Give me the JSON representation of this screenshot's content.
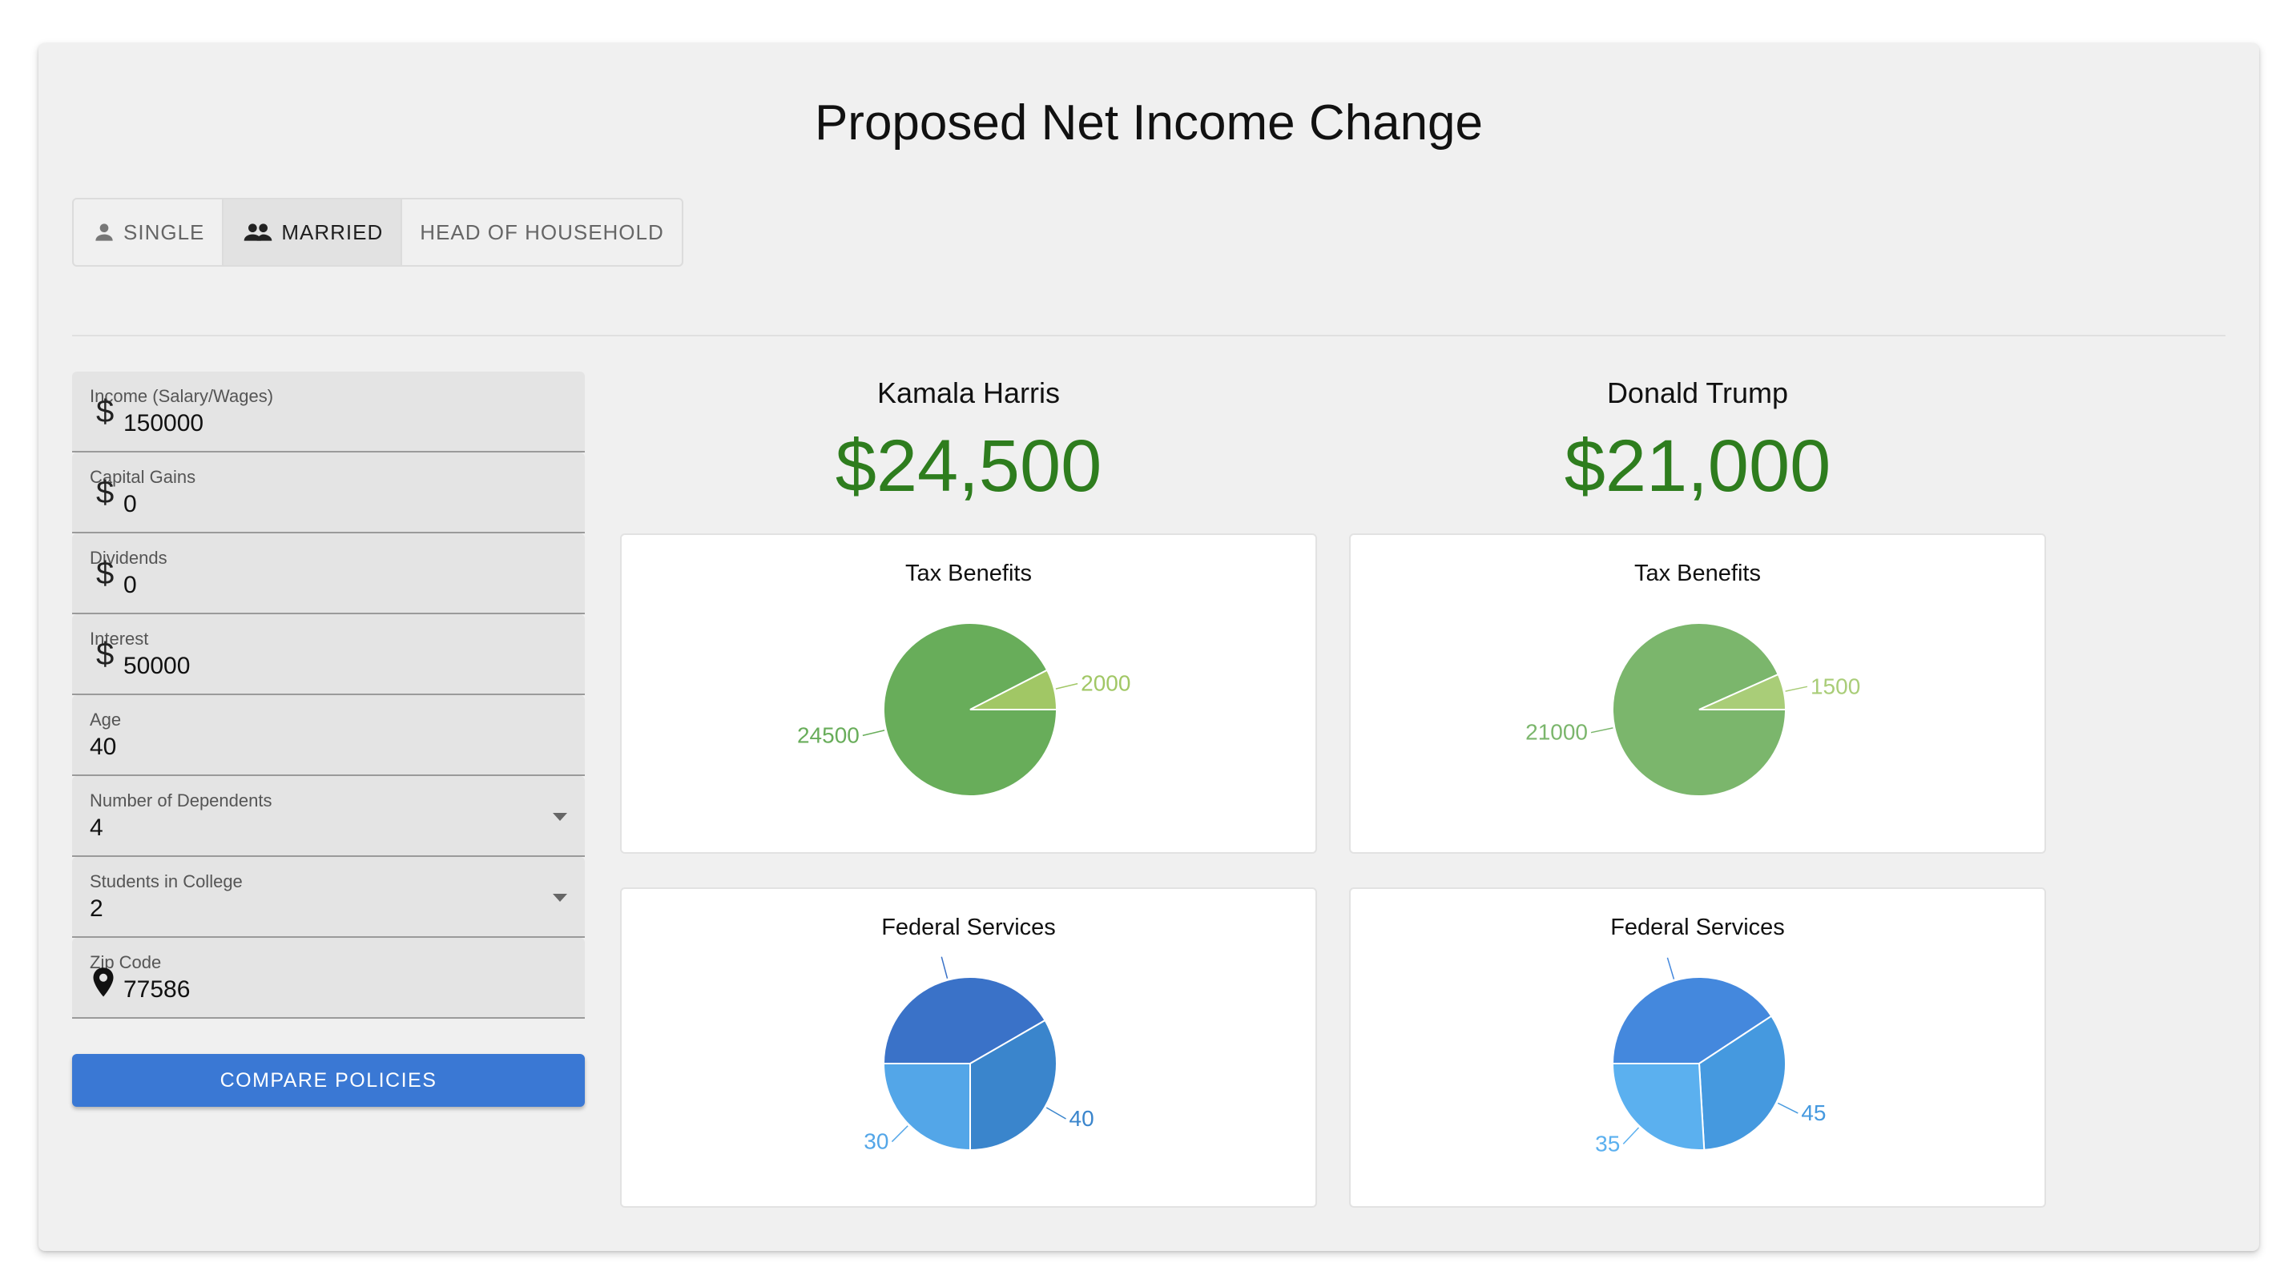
{
  "title": "Proposed Net Income Change",
  "filing_status": {
    "options": [
      {
        "label": "SINGLE",
        "icon": "person-icon",
        "active": false
      },
      {
        "label": "MARRIED",
        "icon": "people-icon",
        "active": true
      },
      {
        "label": "HEAD OF HOUSEHOLD",
        "icon": "",
        "active": false
      }
    ]
  },
  "form": {
    "income": {
      "label": "Income (Salary/Wages)",
      "value": "150000",
      "adornment": "$"
    },
    "capital_gains": {
      "label": "Capital Gains",
      "value": "0",
      "adornment": "$"
    },
    "dividends": {
      "label": "Dividends",
      "value": "0",
      "adornment": "$"
    },
    "interest": {
      "label": "Interest",
      "value": "50000",
      "adornment": "$"
    },
    "age": {
      "label": "Age",
      "value": "40"
    },
    "dependents": {
      "label": "Number of Dependents",
      "value": "4"
    },
    "students": {
      "label": "Students in College",
      "value": "2"
    },
    "zip": {
      "label": "Zip Code",
      "value": "77586",
      "icon": "location-pin-icon"
    },
    "compare_label": "COMPARE POLICIES"
  },
  "candidates": [
    {
      "name": "Kamala Harris",
      "amount": "$24,500"
    },
    {
      "name": "Donald Trump",
      "amount": "$21,000"
    }
  ],
  "colors": {
    "accent": "#3a78d4",
    "amount": "#2e7d1e",
    "harris_tax": [
      "#68ad5a",
      "#a1c765"
    ],
    "trump_tax": [
      "#7bb66c",
      "#a9cd78"
    ],
    "harris_fed": [
      "#3a72c8",
      "#3a85cc",
      "#53a6e8"
    ],
    "trump_fed": [
      "#4488dd",
      "#4599df",
      "#5bb0ef"
    ]
  },
  "chart_data": [
    {
      "type": "pie",
      "title": "Tax Benefits",
      "candidate": "Kamala Harris",
      "values": [
        24500,
        2000
      ],
      "labels": [
        "24500",
        "2000"
      ]
    },
    {
      "type": "pie",
      "title": "Tax Benefits",
      "candidate": "Donald Trump",
      "values": [
        21000,
        1500
      ],
      "labels": [
        "21000",
        "1500"
      ]
    },
    {
      "type": "pie",
      "title": "Federal Services",
      "candidate": "Kamala Harris",
      "values": [
        50,
        40,
        30
      ],
      "labels": [
        "",
        "40",
        "30"
      ]
    },
    {
      "type": "pie",
      "title": "Federal Services",
      "candidate": "Donald Trump",
      "values": [
        55,
        45,
        35
      ],
      "labels": [
        "",
        "45",
        "35"
      ]
    }
  ]
}
